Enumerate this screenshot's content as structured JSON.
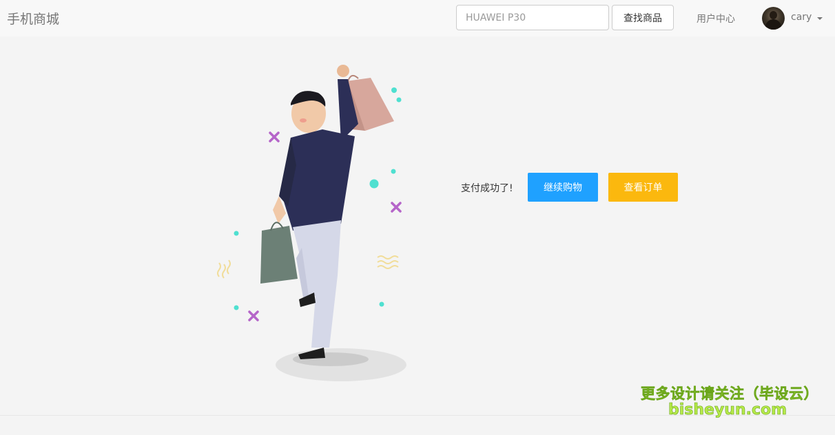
{
  "navbar": {
    "brand": "手机商城",
    "search_placeholder": "HUAWEI P30",
    "search_button": "查找商品",
    "user_center": "用户中心",
    "username": "cary"
  },
  "main": {
    "message": "支付成功了!",
    "continue_button": "继续购物",
    "orders_button": "查看订单"
  },
  "watermark": {
    "line1": "更多设计请关注（毕设云）",
    "line2": "bisheyun.com"
  },
  "colors": {
    "continue_button": "#1fa1ff",
    "orders_button": "#fbb80e",
    "navbar_bg": "#f8f8f8",
    "page_bg": "#f4f4f4"
  }
}
